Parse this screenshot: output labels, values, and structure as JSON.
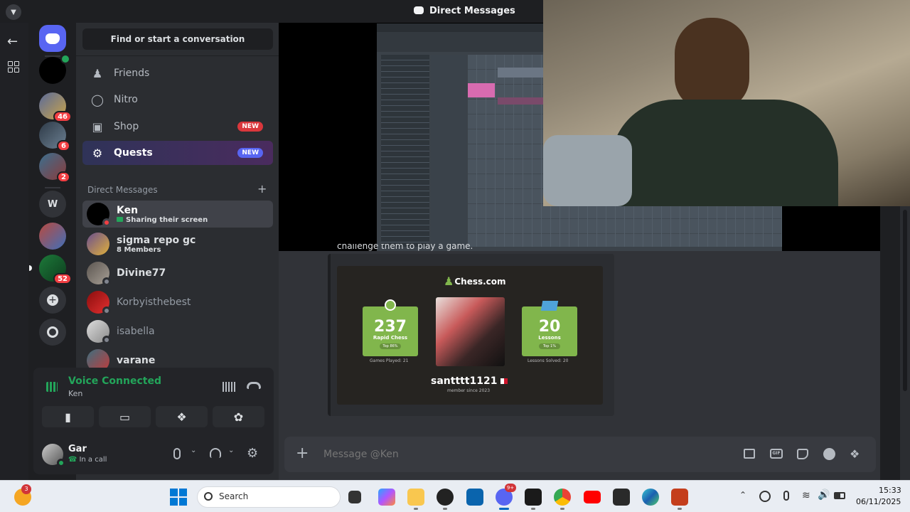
{
  "window": {
    "title": "Direct Messages"
  },
  "servers": {
    "badges": [
      "46",
      "6",
      "2",
      "52"
    ],
    "letter_server": "W"
  },
  "sidebar": {
    "search_label": "Find or start a conversation",
    "nav": [
      {
        "label": "Friends",
        "icon": "friends-icon"
      },
      {
        "label": "Nitro",
        "icon": "nitro-icon"
      },
      {
        "label": "Shop",
        "icon": "shop-icon",
        "badge": "NEW"
      },
      {
        "label": "Quests",
        "icon": "quests-icon",
        "badge": "NEW"
      }
    ],
    "dm_header": "Direct Messages",
    "dms": [
      {
        "name": "Ken",
        "sub": "Sharing their screen"
      },
      {
        "name": "sigma repo gc",
        "sub": "8 Members"
      },
      {
        "name": "Divine77"
      },
      {
        "name": "Korbyisthebest"
      },
      {
        "name": "isabella"
      },
      {
        "name": "varane"
      }
    ]
  },
  "voice": {
    "status": "Voice Connected",
    "channel": "Ken"
  },
  "user": {
    "name": "Gar",
    "status": "In a call"
  },
  "message": {
    "partial_text": "challenge them to play a game.",
    "chess": {
      "site": "Chess.com",
      "tile1": {
        "value": "237",
        "label": "Rapid Chess",
        "pill": "Top 86%",
        "under_label": "Games Played:",
        "under_value": "21"
      },
      "tile2": {
        "value": "20",
        "label": "Lessons",
        "pill": "Top 1%",
        "under_label": "Lessons Solved:",
        "under_value": "20"
      },
      "username": "santttt1121",
      "member_since": "member since 2023"
    }
  },
  "composer": {
    "placeholder": "Message @Ken"
  },
  "taskbar": {
    "search": "Search",
    "time": "15:33",
    "date": "06/11/2025",
    "weather_badge": "3",
    "discord_badge": "9+"
  },
  "colors": {
    "accent": "#5865f2",
    "green": "#23a55a",
    "red": "#da373c",
    "chess_green": "#81b64c"
  }
}
